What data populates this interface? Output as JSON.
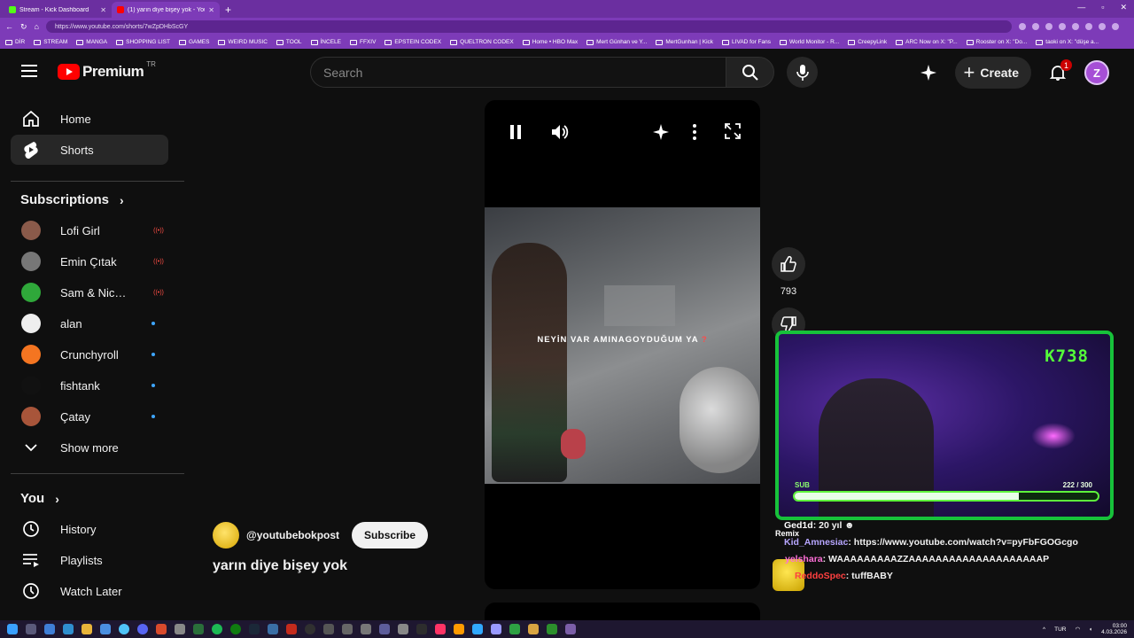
{
  "browser": {
    "tabs": [
      {
        "title": "Stream - Kick Dashboard",
        "active": false,
        "color": "#53fc18"
      },
      {
        "title": "(1) yarın diye bişey yok - YouT",
        "active": true,
        "color": "#ff0000"
      }
    ],
    "new_tab": "+",
    "url": "https://www.youtube.com/shorts/7wZpDHbScGY",
    "bookmarks": [
      "DİR",
      "STREAM",
      "MANGA",
      "SHOPPING LIST",
      "GAMES",
      "WEIRD MUSIC",
      "TOOL",
      "İNCELE",
      "FFXIV",
      "EPSTEIN CODEX",
      "QUELTRON CODEX",
      "Home • HBO Max",
      "Mert Günhan ve Y...",
      "MertGunhan | Kick",
      "LIVAD for Fans",
      "World Monitor - R...",
      "CreepyLink",
      "ARC Now on X: \"P...",
      "Rooster on X: \"Do...",
      "taoki on X: \"düşe a..."
    ]
  },
  "header": {
    "logo_text": "Premium",
    "country": "TR",
    "search_placeholder": "Search",
    "create_label": "Create",
    "notification_count": "1",
    "avatar_letter": "Z"
  },
  "sidebar": {
    "main": [
      {
        "label": "Home",
        "icon": "home-icon"
      },
      {
        "label": "Shorts",
        "icon": "shorts-icon",
        "active": true
      }
    ],
    "subscriptions_heading": "Subscriptions",
    "subscriptions": [
      {
        "name": "Lofi Girl",
        "status": "live",
        "color": "#8a5a4a"
      },
      {
        "name": "Emin Çıtak",
        "status": "live",
        "color": "#777777"
      },
      {
        "name": "Sam & Nick's Per...",
        "status": "live",
        "color": "#2fa83a"
      },
      {
        "name": "alan",
        "status": "new",
        "color": "#eeeeee"
      },
      {
        "name": "Crunchyroll",
        "status": "new",
        "color": "#f47521"
      },
      {
        "name": "fishtank",
        "status": "new",
        "color": "#111111"
      },
      {
        "name": "Çatay",
        "status": "new",
        "color": "#a8553a"
      }
    ],
    "show_more": "Show more",
    "you_heading": "You",
    "you_items": [
      {
        "label": "History",
        "icon": "history-icon"
      },
      {
        "label": "Playlists",
        "icon": "playlists-icon"
      },
      {
        "label": "Watch Later",
        "icon": "watch-later-icon"
      }
    ]
  },
  "short": {
    "caption_white": "NEYİN VAR AMINAGOYDUĞUM YA ",
    "caption_red": "?",
    "channel": "@youtubebokpost",
    "subscribe_label": "Subscribe",
    "title": "yarın diye bişey yok",
    "likes": "793"
  },
  "stream_overlay": {
    "kick_logo": "K738",
    "sub_label": "SUB",
    "sub_current": 222,
    "sub_goal": 300,
    "sub_text": "222 / 300",
    "colors": {
      "border": "#17c23a",
      "accent": "#55ff3a"
    }
  },
  "chat": [
    {
      "user": "Ged1d",
      "message": ": 20 yıl",
      "user_color": "#ffffff"
    },
    {
      "user": "Remix",
      "message": "",
      "user_color": "#ffffff"
    },
    {
      "user": "Kid_Amnesiac",
      "message": ": https://www.youtube.com/watch?v=pyFbFGOGcgo",
      "user_color": "#b7a6ff"
    },
    {
      "user": "yelshara",
      "message": ": WAAAAAAAAAZZAAAAAAAAAAAAAAAAAAAAP",
      "user_color": "#ff6fd8"
    },
    {
      "user": "ReddoSpec",
      "message": ": tuffBABY",
      "user_color": "#ff4040"
    }
  ],
  "taskbar": {
    "lang": "TUR",
    "time": "03:00",
    "date": "4.03.2026"
  }
}
